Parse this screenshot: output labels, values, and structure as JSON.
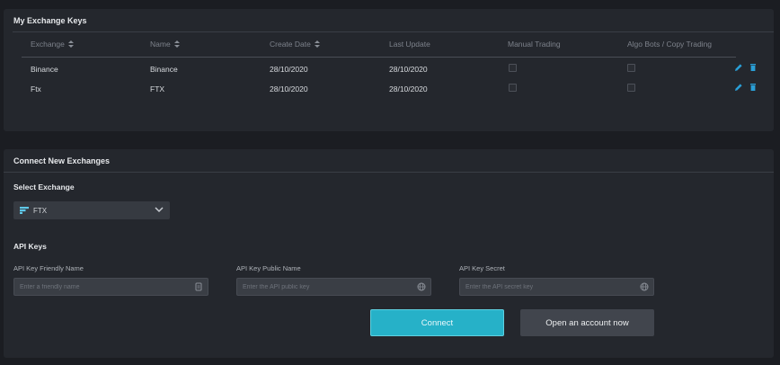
{
  "keys_panel": {
    "title": "My Exchange Keys",
    "columns": [
      "Exchange",
      "Name",
      "Create Date",
      "Last Update",
      "Manual Trading",
      "Algo Bots / Copy Trading"
    ],
    "rows": [
      {
        "exchange": "Binance",
        "name": "Binance",
        "create_date": "28/10/2020",
        "last_update": "28/10/2020",
        "manual_trading": false,
        "algo_bots": false
      },
      {
        "exchange": "Ftx",
        "name": "FTX",
        "create_date": "28/10/2020",
        "last_update": "28/10/2020",
        "manual_trading": false,
        "algo_bots": false
      }
    ],
    "action_icons": [
      "edit-icon",
      "trash-icon"
    ]
  },
  "connect_panel": {
    "title": "Connect New Exchanges",
    "select_label": "Select Exchange",
    "selected_exchange": "FTX",
    "api_keys_label": "API Keys",
    "fields": [
      {
        "label": "API Key Friendly Name",
        "placeholder": "Enter a friendly name",
        "value": ""
      },
      {
        "label": "API Key Public Name",
        "placeholder": "Enter the API public key",
        "value": ""
      },
      {
        "label": "API Key Secret",
        "placeholder": "Enter the API secret key",
        "value": ""
      }
    ],
    "connect_label": "Connect",
    "open_account_label": "Open an account now"
  },
  "colors": {
    "accent": "#26b1c8",
    "panel_bg": "#24272d",
    "page_bg": "#1b1d22",
    "icon_blue": "#2a9fd6"
  }
}
